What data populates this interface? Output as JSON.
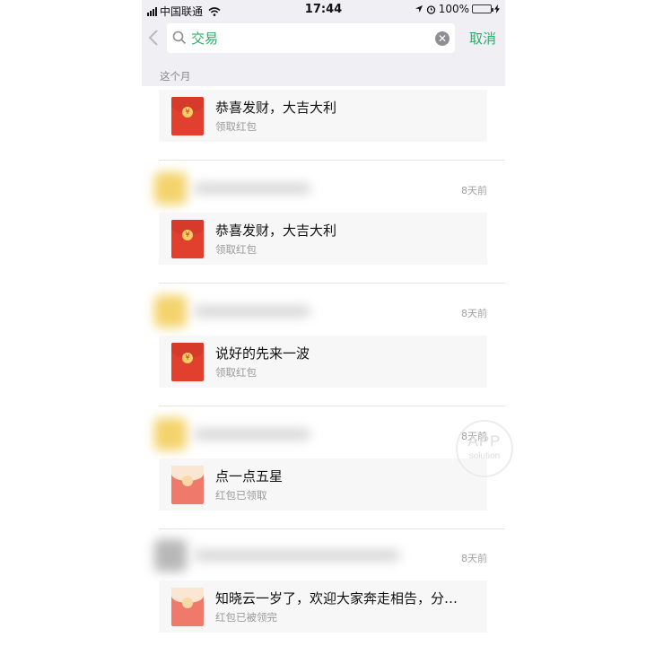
{
  "status_bar": {
    "carrier": "中国联通",
    "time": "17:44",
    "battery": "100%"
  },
  "search": {
    "query": "交易",
    "cancel_label": "取消"
  },
  "section_header": "这个月",
  "items": [
    {
      "title": "恭喜发财，大吉大利",
      "subtitle": "领取红包",
      "state": "unopened"
    },
    {
      "time": "8天前",
      "title": "恭喜发财，大吉大利",
      "subtitle": "领取红包",
      "state": "unopened"
    },
    {
      "time": "8天前",
      "title": "说好的先来一波",
      "subtitle": "领取红包",
      "state": "unopened"
    },
    {
      "time": "8天前",
      "title": "点一点五星",
      "subtitle": "红包已领取",
      "state": "opened"
    },
    {
      "time": "8天前",
      "title": "知晓云一岁了，欢迎大家奔走相告，分…",
      "subtitle": "红包已被领完",
      "state": "opened"
    }
  ],
  "watermark": {
    "line1": "APP",
    "line2": "solution"
  },
  "colors": {
    "accent_green": "#2aae67",
    "packet_red": "#e2402f",
    "packet_opened": "#ef7a6b"
  }
}
